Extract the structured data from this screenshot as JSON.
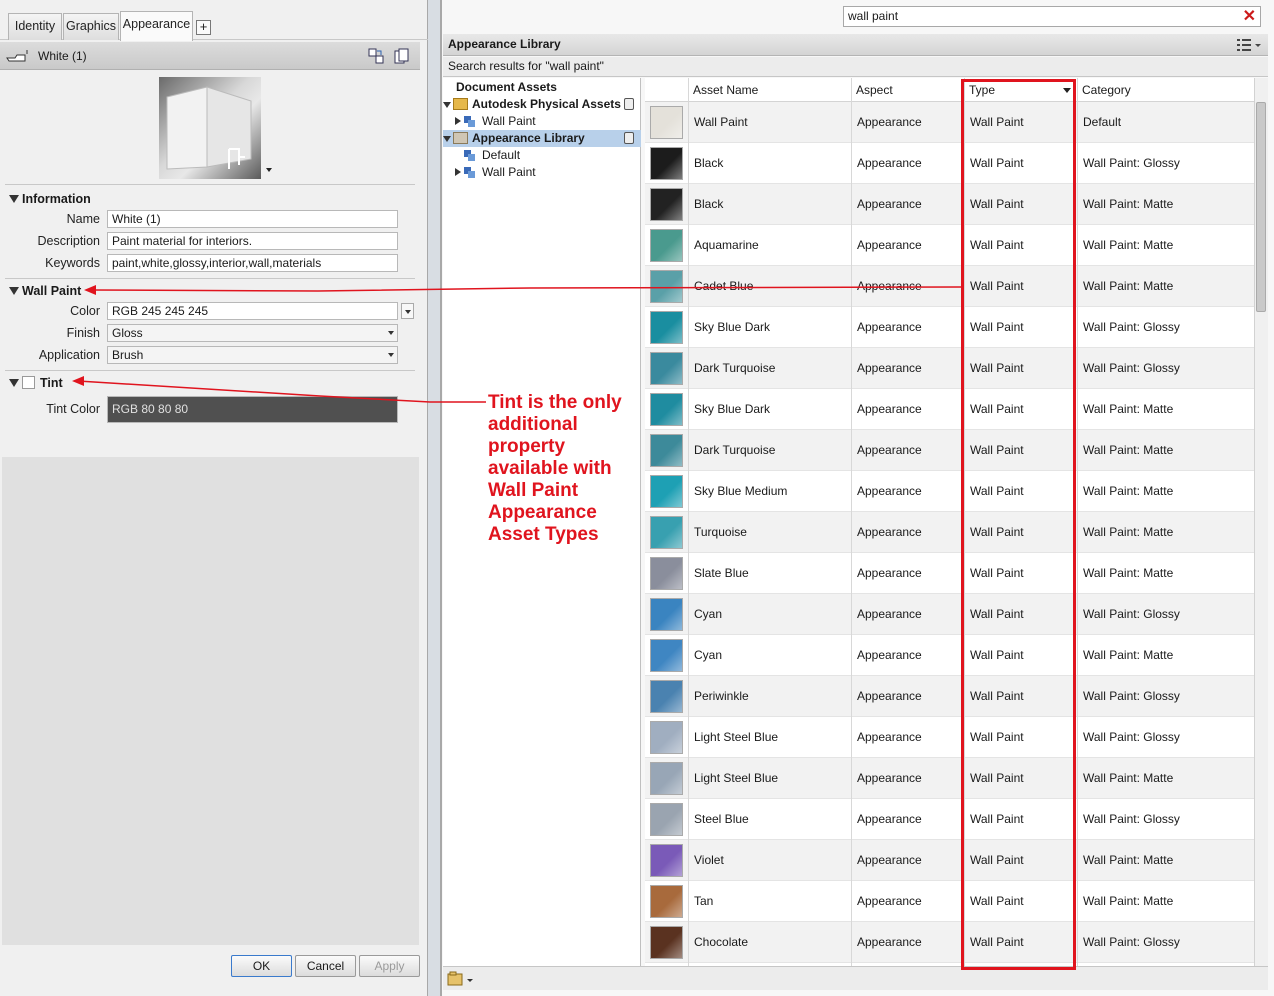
{
  "left": {
    "tabs": [
      {
        "label": "Identity"
      },
      {
        "label": "Graphics"
      },
      {
        "label": "Appearance"
      }
    ],
    "add_tab": "+",
    "asset_name": "White (1)",
    "info_title": "Information",
    "fields": {
      "name": {
        "label": "Name",
        "value": "White (1)"
      },
      "description": {
        "label": "Description",
        "value": "Paint material for interiors."
      },
      "keywords": {
        "label": "Keywords",
        "value": "paint,white,glossy,interior,wall,materials"
      }
    },
    "wall_title": "Wall Paint",
    "color": {
      "label": "Color",
      "value": "RGB 245 245 245"
    },
    "finish": {
      "label": "Finish",
      "value": "Gloss"
    },
    "application": {
      "label": "Application",
      "value": "Brush"
    },
    "tint_title": "Tint",
    "tint_color": {
      "label": "Tint Color",
      "value": "RGB 80 80 80"
    },
    "buttons": {
      "ok": "OK",
      "cancel": "Cancel",
      "apply": "Apply"
    }
  },
  "right": {
    "search_value": "wall paint",
    "library_title": "Appearance Library",
    "search_results": "Search results for \"wall paint\"",
    "tree": [
      {
        "label": "Document Assets"
      },
      {
        "label": "Autodesk Physical Assets"
      },
      {
        "label": "Wall Paint"
      },
      {
        "label": "Appearance Library"
      },
      {
        "label": "Default"
      },
      {
        "label": "Wall Paint"
      }
    ],
    "columns": [
      "Asset Name",
      "Aspect",
      "Type",
      "Category"
    ],
    "rows": [
      {
        "name": "Wall Paint",
        "aspect": "Appearance",
        "type": "Wall Paint",
        "category": "Default",
        "color": "#e4e1da"
      },
      {
        "name": "Black",
        "aspect": "Appearance",
        "type": "Wall Paint",
        "category": "Wall Paint: Glossy",
        "color": "#1c1c1c"
      },
      {
        "name": "Black",
        "aspect": "Appearance",
        "type": "Wall Paint",
        "category": "Wall Paint: Matte",
        "color": "#222222"
      },
      {
        "name": "Aquamarine",
        "aspect": "Appearance",
        "type": "Wall Paint",
        "category": "Wall Paint: Matte",
        "color": "#4a9a8e"
      },
      {
        "name": "Cadet Blue",
        "aspect": "Appearance",
        "type": "Wall Paint",
        "category": "Wall Paint: Matte",
        "color": "#5aa0a8"
      },
      {
        "name": "Sky Blue Dark",
        "aspect": "Appearance",
        "type": "Wall Paint",
        "category": "Wall Paint: Glossy",
        "color": "#1a8ea0"
      },
      {
        "name": "Dark Turquoise",
        "aspect": "Appearance",
        "type": "Wall Paint",
        "category": "Wall Paint: Glossy",
        "color": "#3a8a9e"
      },
      {
        "name": "Sky Blue Dark",
        "aspect": "Appearance",
        "type": "Wall Paint",
        "category": "Wall Paint: Matte",
        "color": "#1f8ca0"
      },
      {
        "name": "Dark Turquoise",
        "aspect": "Appearance",
        "type": "Wall Paint",
        "category": "Wall Paint: Matte",
        "color": "#3d8a9a"
      },
      {
        "name": "Sky Blue Medium",
        "aspect": "Appearance",
        "type": "Wall Paint",
        "category": "Wall Paint: Matte",
        "color": "#1ea0b4"
      },
      {
        "name": "Turquoise",
        "aspect": "Appearance",
        "type": "Wall Paint",
        "category": "Wall Paint: Matte",
        "color": "#38a0b0"
      },
      {
        "name": "Slate Blue",
        "aspect": "Appearance",
        "type": "Wall Paint",
        "category": "Wall Paint: Matte",
        "color": "#8a8e9c"
      },
      {
        "name": "Cyan",
        "aspect": "Appearance",
        "type": "Wall Paint",
        "category": "Wall Paint: Glossy",
        "color": "#3a84c0"
      },
      {
        "name": "Cyan",
        "aspect": "Appearance",
        "type": "Wall Paint",
        "category": "Wall Paint: Matte",
        "color": "#3f86c2"
      },
      {
        "name": "Periwinkle",
        "aspect": "Appearance",
        "type": "Wall Paint",
        "category": "Wall Paint: Glossy",
        "color": "#4a82b0"
      },
      {
        "name": "Light Steel Blue",
        "aspect": "Appearance",
        "type": "Wall Paint",
        "category": "Wall Paint: Glossy",
        "color": "#a0aec0"
      },
      {
        "name": "Light Steel Blue",
        "aspect": "Appearance",
        "type": "Wall Paint",
        "category": "Wall Paint: Matte",
        "color": "#98a6b6"
      },
      {
        "name": "Steel Blue",
        "aspect": "Appearance",
        "type": "Wall Paint",
        "category": "Wall Paint: Glossy",
        "color": "#9aa4b0"
      },
      {
        "name": "Violet",
        "aspect": "Appearance",
        "type": "Wall Paint",
        "category": "Wall Paint: Matte",
        "color": "#7a5ab8"
      },
      {
        "name": "Tan",
        "aspect": "Appearance",
        "type": "Wall Paint",
        "category": "Wall Paint: Matte",
        "color": "#a86a3c"
      },
      {
        "name": "Chocolate",
        "aspect": "Appearance",
        "type": "Wall Paint",
        "category": "Wall Paint: Glossy",
        "color": "#5a3220"
      }
    ]
  },
  "annotation": "Tint is the only additional property available with Wall Paint Appearance Asset Types",
  "colors": {
    "accent_red": "#e0141e",
    "tint_field": "#505050",
    "selected_tree": "#b8d0ea"
  }
}
